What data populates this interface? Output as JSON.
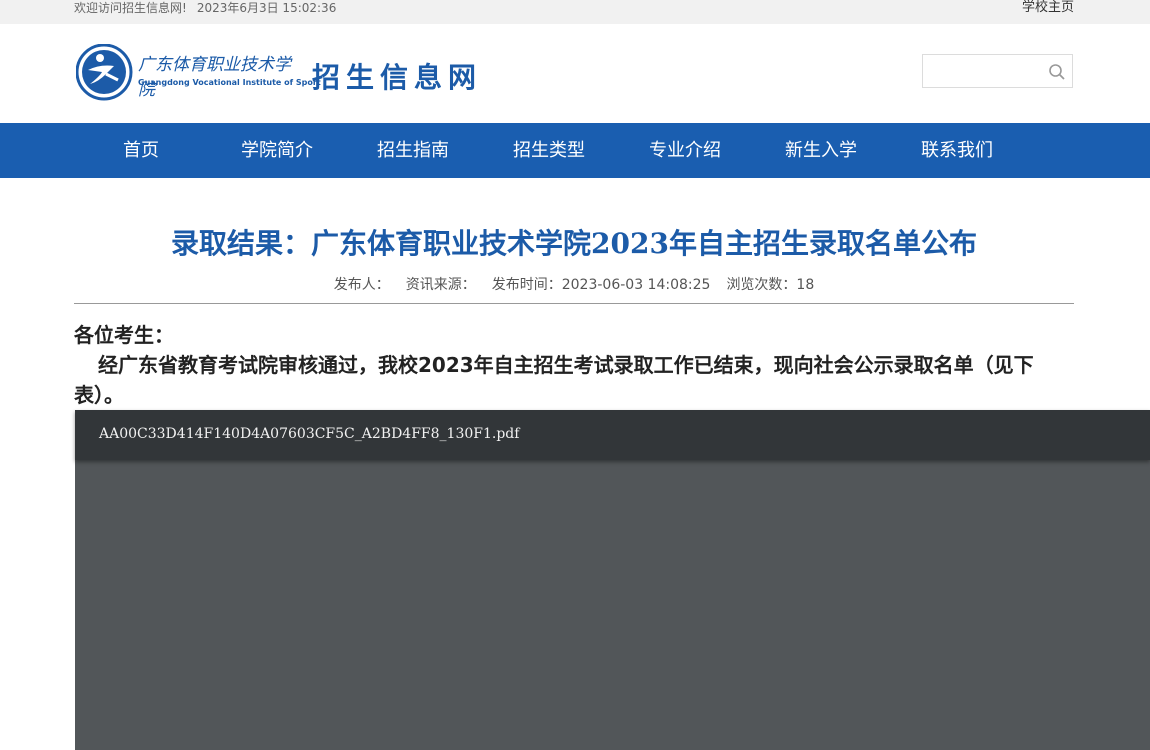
{
  "topbar": {
    "welcome": "欢迎访问招生信息网!",
    "datetime": "2023年6月3日 15:02:36",
    "home_link": "学校主页"
  },
  "header": {
    "logo_text_cn": "广东体育职业技术学院",
    "logo_text_en": "Guangdong Vocational Institute of Sport",
    "site_name": "招生信息网",
    "search": {
      "placeholder": "",
      "value": ""
    },
    "colors": {
      "brand": "#1c5ba8",
      "nav_bg": "#1a5eb0"
    }
  },
  "nav": {
    "items": [
      {
        "label": "首页"
      },
      {
        "label": "学院简介"
      },
      {
        "label": "招生指南"
      },
      {
        "label": "招生类型"
      },
      {
        "label": "专业介绍"
      },
      {
        "label": "新生入学"
      },
      {
        "label": "联系我们"
      }
    ]
  },
  "article": {
    "title": "录取结果：广东体育职业技术学院2023年自主招生录取名单公布",
    "meta": {
      "publisher_label": "发布人：",
      "source_label": "资讯来源：",
      "publish_time": "发布时间：2023-06-03 14:08:25",
      "views": "浏览次数：18"
    },
    "greeting": "各位考生：",
    "paragraph": "经广东省教育考试院审核通过，我校2023年自主招生考试录取工作已结束，现向社会公示录取名单（见下表）。"
  },
  "pdf_viewer": {
    "filename": "AA00C33D414F140D4A07603CF5C_A2BD4FF8_130F1.pdf"
  }
}
